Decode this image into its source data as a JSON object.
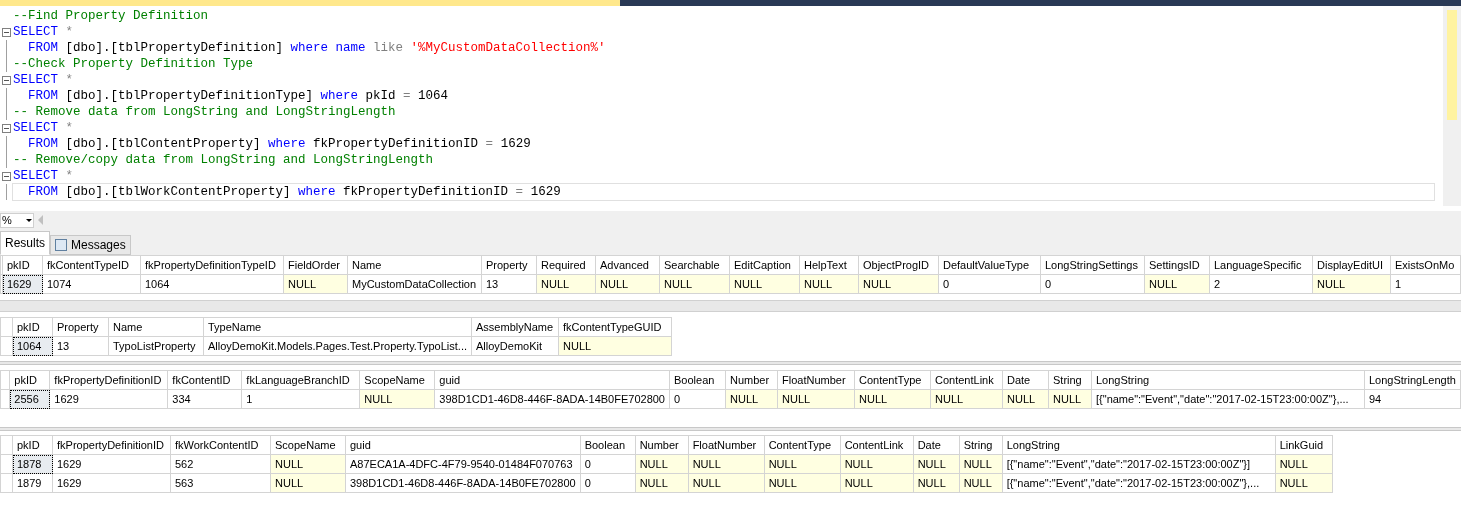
{
  "editor": {
    "lines": [
      {
        "fold_start": false,
        "fold_line": false,
        "current": false,
        "tokens": [
          {
            "kind": "comment",
            "text": "--Find Property Definition"
          }
        ]
      },
      {
        "fold_start": true,
        "fold_line": false,
        "current": false,
        "tokens": [
          {
            "kind": "keyword",
            "text": "SELECT"
          },
          {
            "kind": "operator",
            "text": " *"
          }
        ]
      },
      {
        "fold_start": false,
        "fold_line": true,
        "current": false,
        "tokens": [
          {
            "kind": "keyword",
            "text": "  FROM"
          },
          {
            "kind": "plain",
            "text": " [dbo].[tblPropertyDefinition] "
          },
          {
            "kind": "keyword",
            "text": "where name"
          },
          {
            "kind": "operator",
            "text": " like "
          },
          {
            "kind": "string",
            "text": "'%MyCustomDataCollection%'"
          }
        ]
      },
      {
        "fold_start": false,
        "fold_line": true,
        "current": false,
        "tokens": [
          {
            "kind": "comment",
            "text": "--Check Property Definition Type"
          }
        ]
      },
      {
        "fold_start": true,
        "fold_line": false,
        "current": false,
        "tokens": [
          {
            "kind": "keyword",
            "text": "SELECT"
          },
          {
            "kind": "operator",
            "text": " *"
          }
        ]
      },
      {
        "fold_start": false,
        "fold_line": true,
        "current": false,
        "tokens": [
          {
            "kind": "keyword",
            "text": "  FROM"
          },
          {
            "kind": "plain",
            "text": " [dbo].[tblPropertyDefinitionType] "
          },
          {
            "kind": "keyword",
            "text": "where"
          },
          {
            "kind": "plain",
            "text": " pkId "
          },
          {
            "kind": "operator",
            "text": "="
          },
          {
            "kind": "plain",
            "text": " 1064"
          }
        ]
      },
      {
        "fold_start": false,
        "fold_line": true,
        "current": false,
        "tokens": [
          {
            "kind": "comment",
            "text": "-- Remove data from LongString and LongStringLength"
          }
        ]
      },
      {
        "fold_start": true,
        "fold_line": false,
        "current": false,
        "tokens": [
          {
            "kind": "keyword",
            "text": "SELECT"
          },
          {
            "kind": "operator",
            "text": " *"
          }
        ]
      },
      {
        "fold_start": false,
        "fold_line": true,
        "current": false,
        "tokens": [
          {
            "kind": "keyword",
            "text": "  FROM"
          },
          {
            "kind": "plain",
            "text": " [dbo].[tblContentProperty] "
          },
          {
            "kind": "keyword",
            "text": "where"
          },
          {
            "kind": "plain",
            "text": " fkPropertyDefinitionID "
          },
          {
            "kind": "operator",
            "text": "="
          },
          {
            "kind": "plain",
            "text": " 1629"
          }
        ]
      },
      {
        "fold_start": false,
        "fold_line": true,
        "current": false,
        "tokens": [
          {
            "kind": "comment",
            "text": "-- Remove/copy data from LongString and LongStringLength"
          }
        ]
      },
      {
        "fold_start": true,
        "fold_line": false,
        "current": false,
        "tokens": [
          {
            "kind": "keyword",
            "text": "SELECT"
          },
          {
            "kind": "operator",
            "text": " *"
          }
        ]
      },
      {
        "fold_start": false,
        "fold_line": true,
        "current": true,
        "tokens": [
          {
            "kind": "keyword",
            "text": "  FROM"
          },
          {
            "kind": "plain",
            "text": " [dbo].[tblWorkContentProperty] "
          },
          {
            "kind": "keyword",
            "text": "where"
          },
          {
            "kind": "plain",
            "text": " fkPropertyDefinitionID "
          },
          {
            "kind": "operator",
            "text": "="
          },
          {
            "kind": "plain",
            "text": " 1629"
          }
        ]
      }
    ]
  },
  "zoom": {
    "value": "%"
  },
  "tabs": [
    {
      "label": "Results",
      "selected": true
    },
    {
      "label": "Messages",
      "selected": false
    }
  ],
  "grids": [
    {
      "columns": [
        "pkID",
        "fkContentTypeID",
        "fkPropertyDefinitionTypeID",
        "FieldOrder",
        "Name",
        "Property",
        "Required",
        "Advanced",
        "Searchable",
        "EditCaption",
        "HelpText",
        "ObjectProgID",
        "DefaultValueType",
        "LongStringSettings",
        "SettingsID",
        "LanguageSpecific",
        "DisplayEditUI",
        "ExistsOnMo"
      ],
      "rows": [
        {
          "selected": true,
          "cells": [
            {
              "text": "1629",
              "null": false
            },
            {
              "text": "1074",
              "null": false
            },
            {
              "text": "1064",
              "null": false
            },
            {
              "text": "NULL",
              "null": true
            },
            {
              "text": "MyCustomDataCollection",
              "null": false
            },
            {
              "text": "13",
              "null": false
            },
            {
              "text": "NULL",
              "null": true
            },
            {
              "text": "NULL",
              "null": true
            },
            {
              "text": "NULL",
              "null": true
            },
            {
              "text": "NULL",
              "null": true
            },
            {
              "text": "NULL",
              "null": true
            },
            {
              "text": "NULL",
              "null": true
            },
            {
              "text": "0",
              "null": false
            },
            {
              "text": "0",
              "null": false
            },
            {
              "text": "NULL",
              "null": true
            },
            {
              "text": "2",
              "null": false
            },
            {
              "text": "NULL",
              "null": true
            },
            {
              "text": "1",
              "null": false
            }
          ]
        }
      ]
    },
    {
      "columns": [
        "pkID",
        "Property",
        "Name",
        "TypeName",
        "AssemblyName",
        "fkContentTypeGUID"
      ],
      "rows": [
        {
          "selected": true,
          "cells": [
            {
              "text": "1064",
              "null": false
            },
            {
              "text": "13",
              "null": false
            },
            {
              "text": "TypoListProperty",
              "null": false
            },
            {
              "text": "AlloyDemoKit.Models.Pages.Test.Property.TypoList...",
              "null": false
            },
            {
              "text": "AlloyDemoKit",
              "null": false
            },
            {
              "text": "NULL",
              "null": true
            }
          ]
        }
      ]
    },
    {
      "columns": [
        "pkID",
        "fkPropertyDefinitionID",
        "fkContentID",
        "fkLanguageBranchID",
        "ScopeName",
        "guid",
        "Boolean",
        "Number",
        "FloatNumber",
        "ContentType",
        "ContentLink",
        "Date",
        "String",
        "LongString",
        "LongStringLength"
      ],
      "rows": [
        {
          "selected": true,
          "cells": [
            {
              "text": "2556",
              "null": false
            },
            {
              "text": "1629",
              "null": false
            },
            {
              "text": "334",
              "null": false
            },
            {
              "text": "1",
              "null": false
            },
            {
              "text": "NULL",
              "null": true
            },
            {
              "text": "398D1CD1-46D8-446F-8ADA-14B0FE702800",
              "null": false
            },
            {
              "text": "0",
              "null": false
            },
            {
              "text": "NULL",
              "null": true
            },
            {
              "text": "NULL",
              "null": true
            },
            {
              "text": "NULL",
              "null": true
            },
            {
              "text": "NULL",
              "null": true
            },
            {
              "text": "NULL",
              "null": true
            },
            {
              "text": "NULL",
              "null": true
            },
            {
              "text": "[{\"name\":\"Event\",\"date\":\"2017-02-15T23:00:00Z\"},...",
              "null": false
            },
            {
              "text": "94",
              "null": false
            }
          ]
        }
      ]
    },
    {
      "columns": [
        "pkID",
        "fkPropertyDefinitionID",
        "fkWorkContentID",
        "ScopeName",
        "guid",
        "Boolean",
        "Number",
        "FloatNumber",
        "ContentType",
        "ContentLink",
        "Date",
        "String",
        "LongString",
        "LinkGuid"
      ],
      "rows": [
        {
          "selected": true,
          "cells": [
            {
              "text": "1878",
              "null": false
            },
            {
              "text": "1629",
              "null": false
            },
            {
              "text": "562",
              "null": false
            },
            {
              "text": "NULL",
              "null": true
            },
            {
              "text": "A87ECA1A-4DFC-4F79-9540-01484F070763",
              "null": false
            },
            {
              "text": "0",
              "null": false
            },
            {
              "text": "NULL",
              "null": true
            },
            {
              "text": "NULL",
              "null": true
            },
            {
              "text": "NULL",
              "null": true
            },
            {
              "text": "NULL",
              "null": true
            },
            {
              "text": "NULL",
              "null": true
            },
            {
              "text": "NULL",
              "null": true
            },
            {
              "text": "[{\"name\":\"Event\",\"date\":\"2017-02-15T23:00:00Z\"}]",
              "null": false
            },
            {
              "text": "NULL",
              "null": true
            }
          ]
        },
        {
          "selected": false,
          "cells": [
            {
              "text": "1879",
              "null": false
            },
            {
              "text": "1629",
              "null": false
            },
            {
              "text": "563",
              "null": false
            },
            {
              "text": "NULL",
              "null": true
            },
            {
              "text": "398D1CD1-46D8-446F-8ADA-14B0FE702800",
              "null": false
            },
            {
              "text": "0",
              "null": false
            },
            {
              "text": "NULL",
              "null": true
            },
            {
              "text": "NULL",
              "null": true
            },
            {
              "text": "NULL",
              "null": true
            },
            {
              "text": "NULL",
              "null": true
            },
            {
              "text": "NULL",
              "null": true
            },
            {
              "text": "NULL",
              "null": true
            },
            {
              "text": "[{\"name\":\"Event\",\"date\":\"2017-02-15T23:00:00Z\"},...",
              "null": false
            },
            {
              "text": "NULL",
              "null": true
            }
          ]
        }
      ]
    }
  ]
}
